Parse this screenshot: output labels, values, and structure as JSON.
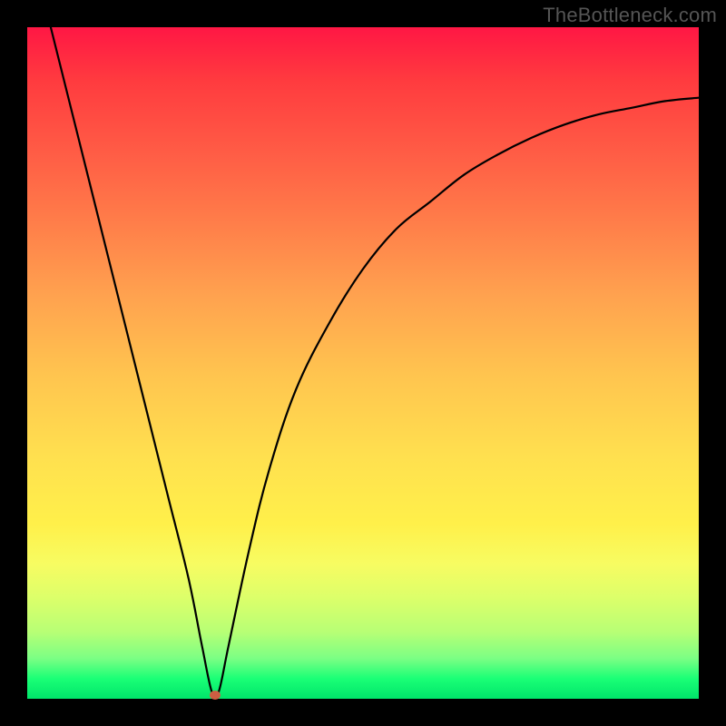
{
  "watermark": "TheBottleneck.com",
  "chart_data": {
    "type": "line",
    "title": "",
    "xlabel": "",
    "ylabel": "",
    "xlim": [
      0,
      100
    ],
    "ylim": [
      0,
      100
    ],
    "grid": false,
    "marker": {
      "x": 28,
      "y": 0.5,
      "color": "#cc5e42"
    },
    "series": [
      {
        "name": "left-branch",
        "x": [
          3.5,
          6,
          9,
          12,
          15,
          18,
          21,
          24,
          26,
          27.5
        ],
        "values": [
          100,
          90,
          78,
          66,
          54,
          42,
          30,
          18,
          8,
          1
        ]
      },
      {
        "name": "right-branch",
        "x": [
          28.5,
          30,
          33,
          36,
          40,
          45,
          50,
          55,
          60,
          65,
          70,
          75,
          80,
          85,
          90,
          95,
          100
        ],
        "values": [
          1,
          8,
          22,
          34,
          46,
          56,
          64,
          70,
          74,
          78,
          81,
          83.5,
          85.5,
          87,
          88,
          89,
          89.5
        ]
      }
    ]
  }
}
